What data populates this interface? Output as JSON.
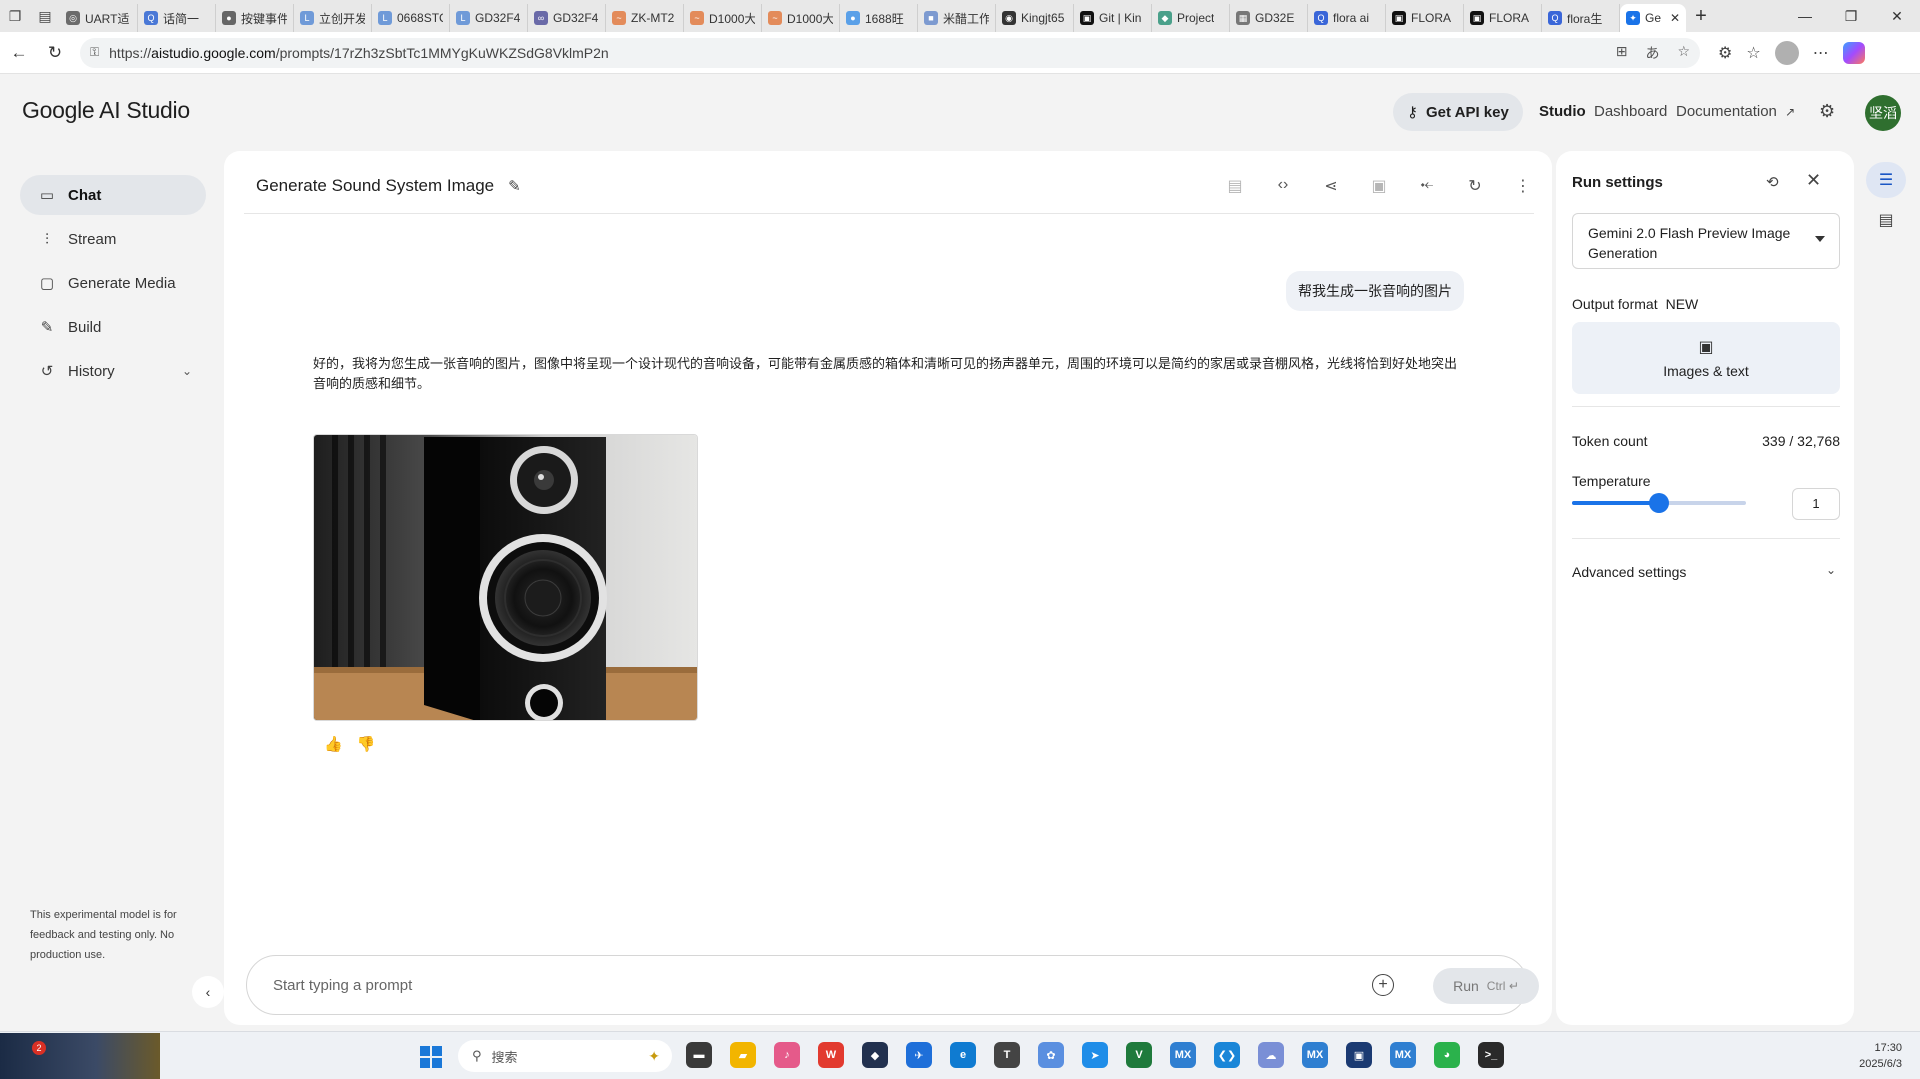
{
  "browser": {
    "tabs": [
      {
        "label": "UART适",
        "color": "#6b6b6b",
        "glyph": "◎"
      },
      {
        "label": "话简一",
        "color": "#4a78d6",
        "glyph": "Q"
      },
      {
        "label": "按键事件",
        "color": "#666666",
        "glyph": "●"
      },
      {
        "label": "立创开发",
        "color": "#6f9ad8",
        "glyph": "L"
      },
      {
        "label": "0668STC",
        "color": "#6f9ad8",
        "glyph": "L"
      },
      {
        "label": "GD32F4",
        "color": "#6f9ad8",
        "glyph": "L"
      },
      {
        "label": "GD32F4",
        "color": "#6a6aa8",
        "glyph": "∞"
      },
      {
        "label": "ZK-MT2",
        "color": "#e38b5a",
        "glyph": "~"
      },
      {
        "label": "D1000大",
        "color": "#e38b5a",
        "glyph": "~"
      },
      {
        "label": "D1000大",
        "color": "#e38b5a",
        "glyph": "~"
      },
      {
        "label": "1688旺",
        "color": "#5aa0e8",
        "glyph": "●"
      },
      {
        "label": "米醋工作",
        "color": "#7d9ad0",
        "glyph": "■"
      },
      {
        "label": "Kingjt65",
        "color": "#333333",
        "glyph": "◉"
      },
      {
        "label": "Git | Kin",
        "color": "#111111",
        "glyph": "▣"
      },
      {
        "label": "Project",
        "color": "#4aa08a",
        "glyph": "◆"
      },
      {
        "label": "GD32E",
        "color": "#777777",
        "glyph": "▦"
      },
      {
        "label": "flora ai",
        "color": "#3a66d8",
        "glyph": "Q"
      },
      {
        "label": "FLORA",
        "color": "#111111",
        "glyph": "▣"
      },
      {
        "label": "FLORA",
        "color": "#111111",
        "glyph": "▣"
      },
      {
        "label": "flora生",
        "color": "#3a66d8",
        "glyph": "Q"
      }
    ],
    "active_tab": {
      "label": "Ge",
      "color": "#1a73e8",
      "glyph": "✦"
    },
    "url_prefix": "https://",
    "url_host": "aistudio.google.com",
    "url_path": "/prompts/17rZh3zSbtTc1MMYgKuWKZSdG8VklmP2n"
  },
  "header": {
    "logo": "Google AI Studio",
    "api_key_label": "Get API key",
    "nav": {
      "studio": "Studio",
      "dashboard": "Dashboard",
      "documentation": "Documentation"
    },
    "avatar_text": "坚滔"
  },
  "sidebar": {
    "items": [
      {
        "label": "Chat",
        "icon": "chat-icon",
        "active": true
      },
      {
        "label": "Stream",
        "icon": "stream-icon",
        "active": false
      },
      {
        "label": "Generate Media",
        "icon": "media-icon",
        "active": false
      },
      {
        "label": "Build",
        "icon": "build-icon",
        "active": false
      },
      {
        "label": "History",
        "icon": "history-icon",
        "active": false
      }
    ],
    "disclaimer": "This experimental model is for feedback and testing only. No production use."
  },
  "chat": {
    "title": "Generate Sound System Image",
    "user_message": "帮我生成一张音响的图片",
    "model_message": "好的，我将为您生成一张音响的图片，图像中将呈现一个设计现代的音响设备，可能带有金属质感的箱体和清晰可见的扬声器单元，周围的环境可以是简约的家居或录音棚风格，光线将恰到好处地突出音响的质感和细节。",
    "prompt_placeholder": "Start typing a prompt",
    "run_label": "Run",
    "run_shortcut": "Ctrl"
  },
  "run_settings": {
    "title": "Run settings",
    "model_name": "Gemini 2.0 Flash Preview Image Generation",
    "output_format_label": "Output format",
    "output_format_badge": "NEW",
    "output_format_value": "Images & text",
    "token_count_label": "Token count",
    "token_count_value": "339 / 32,768",
    "temperature_label": "Temperature",
    "temperature_value": "1",
    "temperature_level": 0.5,
    "advanced_label": "Advanced settings"
  },
  "taskbar": {
    "badge_count": "2",
    "search_placeholder": "搜索",
    "apps": [
      {
        "name": "file-manager-app",
        "color": "#3a3a3a",
        "glyph": "▬"
      },
      {
        "name": "folder-app",
        "color": "#f2b500",
        "glyph": "▰"
      },
      {
        "name": "audio-app",
        "color": "#e55a8a",
        "glyph": "♪"
      },
      {
        "name": "wps-app",
        "color": "#e23a2f",
        "glyph": "W"
      },
      {
        "name": "cat-app",
        "color": "#22314f",
        "glyph": "◆"
      },
      {
        "name": "bird-app",
        "color": "#1e6fd9",
        "glyph": "✈"
      },
      {
        "name": "edge-app",
        "color": "#0f7bd1",
        "glyph": "e"
      },
      {
        "name": "typora-app",
        "color": "#444444",
        "glyph": "T"
      },
      {
        "name": "network-app",
        "color": "#5a8fe0",
        "glyph": "✿"
      },
      {
        "name": "send-app",
        "color": "#1f8de8",
        "glyph": "➤"
      },
      {
        "name": "sheet-app",
        "color": "#1f7a3c",
        "glyph": "V"
      },
      {
        "name": "stm-mx-app",
        "color": "#2f7fd1",
        "glyph": "MX"
      },
      {
        "name": "vscode-app",
        "color": "#1a86d8",
        "glyph": "❮❯"
      },
      {
        "name": "cloud-app",
        "color": "#7a8fd6",
        "glyph": "☁"
      },
      {
        "name": "stm-mx-app-2",
        "color": "#2f7fd1",
        "glyph": "MX"
      },
      {
        "name": "chip-app",
        "color": "#1b3a72",
        "glyph": "▣"
      },
      {
        "name": "stm-mx-app-3",
        "color": "#2f7fd1",
        "glyph": "MX"
      },
      {
        "name": "wechat-app",
        "color": "#2bb24c",
        "glyph": "◕"
      },
      {
        "name": "terminal-app",
        "color": "#2a2a2a",
        "glyph": ">_"
      }
    ],
    "time": "17:30",
    "date": "2025/6/3"
  }
}
